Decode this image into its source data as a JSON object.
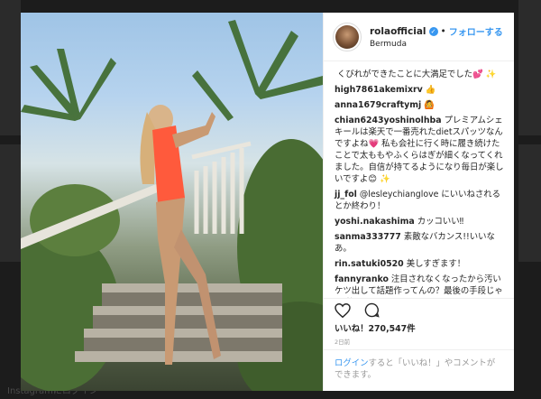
{
  "post": {
    "username": "rolaofficial",
    "verified_mark": "✓",
    "separator": "•",
    "follow_label": "フォローする",
    "location": "Bermuda"
  },
  "comments": [
    {
      "user": "",
      "text": "くびれができたことに大満足でした💕 ✨"
    },
    {
      "user": "high7861akemixrv",
      "text": "👍"
    },
    {
      "user": "anna1679craftymj",
      "text": "🙆"
    },
    {
      "user": "chian6243yoshinolhba",
      "text": "プレミアムシェキールは楽天で一番売れたdietスパッツなんですよね💗 私も会社に行く時に履き続けたことで太ももやふくらはぎが細くなってくれました。自信が持てるようになり毎日が楽しいですよ😊 ✨"
    },
    {
      "user": "jj_fol",
      "text": "@lesleychianglove にいいねされるとか終わり！"
    },
    {
      "user": "yoshi.nakashima",
      "text": "カッコいい‼"
    },
    {
      "user": "sanma333777",
      "text": "素敵なバカンス!!いいなあ。"
    },
    {
      "user": "rin.satuki0520",
      "text": "美しすぎます！"
    },
    {
      "user": "fannyranko",
      "text": "注目されなくなったから汚いケツ出して話題作ってんの？最後の手段じゃね(笑)"
    }
  ],
  "likes": "いいね！270,547件",
  "timestamp": "2日前",
  "login": {
    "link_label": "ログイン",
    "text": "すると「いいね！」やコメントができます。"
  },
  "background_link": "Instagramにログイン",
  "colors": {
    "accent": "#3897f0",
    "text": "#262626",
    "muted": "#999999"
  },
  "icons": {
    "like": "heart-icon",
    "comment": "speech-bubble-icon",
    "verified": "verified-badge-icon"
  }
}
